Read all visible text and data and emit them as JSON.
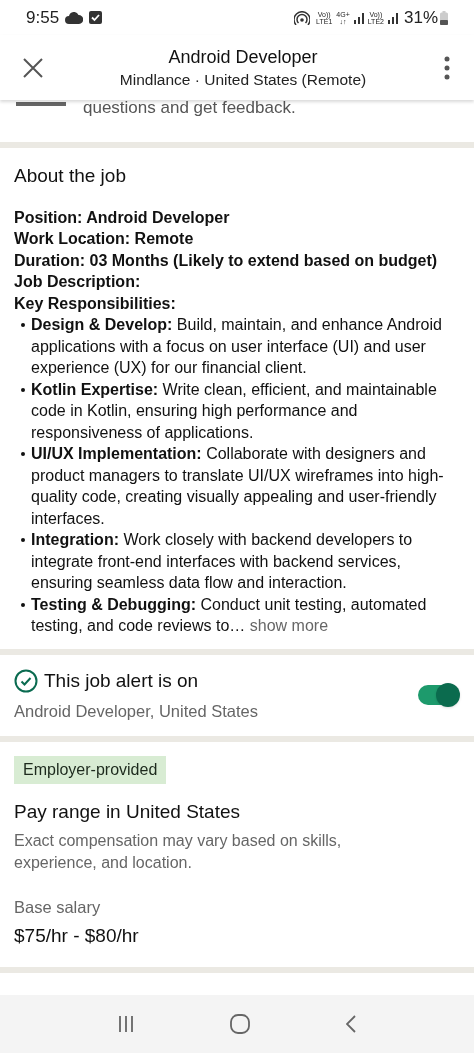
{
  "status_bar": {
    "time": "9:55",
    "network_labels": [
      {
        "top": "Vo))",
        "bottom": "LTE1"
      },
      {
        "top": "4G+",
        "bottom": "↓↑"
      },
      {
        "top": "Vo))",
        "bottom": "LTE2"
      }
    ],
    "battery": "31%"
  },
  "header": {
    "title": "Android Developer",
    "subtitle": "Mindlance · United States (Remote)"
  },
  "partial_text": "questions and get feedback.",
  "about": {
    "heading": "About the job",
    "lines": [
      "Position: Android Developer",
      "Work Location: Remote",
      "Duration: 03 Months (Likely to extend based on budget)",
      "Job Description:",
      "Key Responsibilities:"
    ],
    "bullets": [
      "**Design & Develop:** Build, maintain, and enhance Android applications with a focus on user interface (UI) and user experience (UX) for our financial client.",
      "**Kotlin Expertise:** Write clean, efficient, and maintainable code in Kotlin, ensuring high performance and responsiveness of applications.",
      "**UI/UX Implementation:** Collaborate with designers and product managers to translate UI/UX wireframes into high-quality code, creating visually appealing and user-friendly interfaces.",
      "**Integration:** Work closely with backend developers to integrate front-end interfaces with backend services, ensuring seamless data flow and interaction.",
      "**Testing & Debugging:** Conduct unit testing, automated testing, and code reviews to…"
    ],
    "show_more": "show more"
  },
  "alert": {
    "title": "This job alert is on",
    "subtitle": "Android Developer, United States",
    "on": true
  },
  "pay": {
    "badge": "Employer-provided",
    "heading": "Pay range in United States",
    "note": "Exact compensation may vary based on skills, experience, and location.",
    "label": "Base salary",
    "value": "$75/hr - $80/hr"
  }
}
